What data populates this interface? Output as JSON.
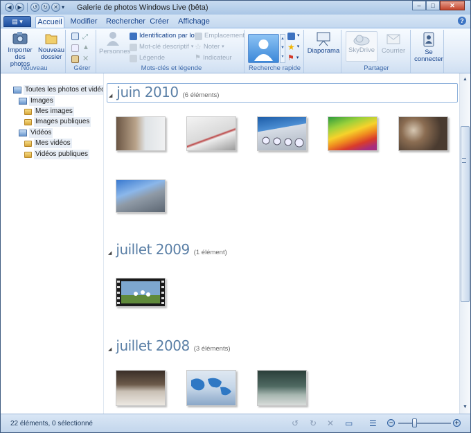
{
  "window": {
    "title": "Galerie de photos Windows Live (bêta)",
    "controls": {
      "minimize": "–",
      "maximize": "□",
      "close": "✕"
    }
  },
  "tabs": [
    {
      "label": "Accueil",
      "active": true
    },
    {
      "label": "Modifier"
    },
    {
      "label": "Rechercher"
    },
    {
      "label": "Créer"
    },
    {
      "label": "Affichage"
    }
  ],
  "ribbon": {
    "nouveau": {
      "label": "Nouveau",
      "import_label": "Importer des photos",
      "new_folder_label": "Nouveau dossier"
    },
    "gerer": {
      "label": "Gérer"
    },
    "motscles": {
      "label": "Mots-clés et légende",
      "personnes_label": "Personnes",
      "identification_label": "Identification par lot",
      "motcle_label": "Mot-clé descriptif",
      "legende_label": "Légende",
      "emplacement_label": "Emplacement",
      "noter_label": "Noter",
      "indicateur_label": "Indicateur"
    },
    "recherche": {
      "label": "Recherche rapide"
    },
    "diaporama": {
      "label": "Diaporama"
    },
    "partager": {
      "label": "Partager",
      "skydrive_label": "SkyDrive",
      "courrier_label": "Courrier"
    },
    "connect": {
      "label": "Se connecter"
    }
  },
  "nav": {
    "root": "Toutes les photos et vidéos",
    "images": "Images",
    "mes_images": "Mes images",
    "images_publiques": "Images publiques",
    "videos": "Vidéos",
    "mes_videos": "Mes vidéos",
    "videos_publiques": "Vidéos publiques"
  },
  "sections": [
    {
      "date": "juin 2010",
      "count": "(6 éléments)"
    },
    {
      "date": "juillet 2009",
      "count": "(1 élément)"
    },
    {
      "date": "juillet 2008",
      "count": "(3 éléments)"
    }
  ],
  "status": {
    "text": "22 éléments, 0 sélectionné"
  },
  "zoom_level": 0.3
}
